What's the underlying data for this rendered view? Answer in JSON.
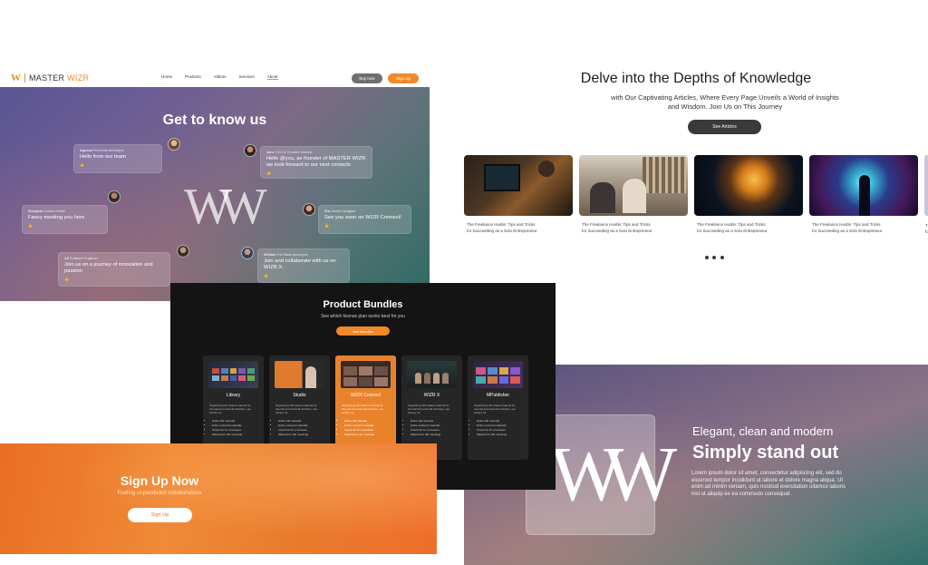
{
  "header": {
    "logo_mark": "W",
    "logo_text_master": "MASTER ",
    "logo_text_wizr": "WIZR",
    "nav": [
      "Home",
      "Products",
      "Videos",
      "Services",
      "About"
    ],
    "buy_now": "Buy now",
    "sign_up": "Sign Up"
  },
  "know_us": {
    "title": "Get to know us",
    "logo_letter": "W",
    "bubbles": [
      {
        "name": "Agnesa",
        "role": "Front end developer",
        "message": "Hello from our team",
        "reaction": "👍"
      },
      {
        "name": "Jane",
        "role": "CEO & Creative director",
        "message": "Hello @you, as founder of MASTER WIZR we look forward to our next contacts",
        "reaction": "👍"
      },
      {
        "name": "Shenjeta",
        "role": "Content Writer",
        "message": "Fancy meeting you here",
        "reaction": "👍"
      },
      {
        "name": "Era",
        "role": "Senior Designer",
        "message": "See you soon on WIZR Connect!",
        "reaction": "👍"
      },
      {
        "name": "Ali",
        "role": "Software Engineer",
        "message": "Join us on a journey of innovation and passion",
        "reaction": "👍"
      },
      {
        "name": "William",
        "role": "Full Stack developer",
        "message": "Join and collaborate with us on WIZR X.",
        "reaction": "👍"
      }
    ]
  },
  "delve": {
    "title": "Delve into the Depths of Knowledge",
    "subtitle": "with Our Captivating Articles, Where Every Page Unveils a World of Insights and Wisdom. Join Us on This Journey",
    "button": "See Articles",
    "cards": [
      {
        "caption_line1": "The Freelance Hustle: Tips and Tricks",
        "caption_line2": "for Succeeding as a Solo Entrepreneur"
      },
      {
        "caption_line1": "The Freelance Hustle: Tips and Tricks",
        "caption_line2": "for Succeeding as a Solo Entrepreneur"
      },
      {
        "caption_line1": "The Freelance Hustle: Tips and Tricks",
        "caption_line2": "for Succeeding as a Solo Entrepreneur"
      },
      {
        "caption_line1": "The Freelance Hustle: Tips and Tricks",
        "caption_line2": "for Succeeding as a Solo Entrepreneur"
      }
    ]
  },
  "bundles": {
    "title": "Product Bundles",
    "subtitle": "See which license plan works best for you",
    "button": "See Bundles",
    "items": [
      {
        "name": "Library",
        "desc": "Organizing HR related material for internal and external activities, use Library for:",
        "bullets": [
          "Entire HR manuals",
          "Entire onboard materials",
          "Check list for processes",
          "Material for HR meetings"
        ]
      },
      {
        "name": "Studio",
        "desc": "Organizing HR related material for internal and external activities, use Library for:",
        "bullets": [
          "Entire HR manuals",
          "Entire onboard materials",
          "Check list for processes",
          "Material for HR meetings"
        ]
      },
      {
        "name": "WIZR Connect",
        "desc": "Organizing HR related material for internal and external activities, use Library for:",
        "bullets": [
          "Entire HR manuals",
          "Entire onboard materials",
          "Check list for processes",
          "Material for HR meetings"
        ]
      },
      {
        "name": "WIZR X",
        "desc": "Organizing HR related material for internal and external activities, use Library for:",
        "bullets": [
          "Entire HR manuals",
          "Entire onboard materials",
          "Check list for processes",
          "Material for HR meetings"
        ]
      },
      {
        "name": "MPublisher",
        "desc": "Organizing HR related material for internal and external activities, use Library for:",
        "bullets": [
          "Entire HR manuals",
          "Entire onboard materials",
          "Check list for processes",
          "Material for HR meetings"
        ]
      }
    ]
  },
  "signup": {
    "title": "Sign Up Now",
    "subtitle": "Fueling unparalleled collaborations",
    "button": "Sign Up"
  },
  "standout": {
    "logo_letter": "W",
    "kicker": "Elegant, clean and modern",
    "title": "Simply stand out",
    "body": "Lorem ipsum dolor sit amet, consectetur adipiscing elit, sed do eiusmod tempor incididunt ut labore et dolore magna aliqua. Ut enim ad minim veniam, quis nostrud exercitation ullamco laboris nisi ut aliquip ex ea commodo consequat"
  },
  "colors": {
    "brand_orange": "#f0892b",
    "dark_button": "#3a3a3c"
  }
}
